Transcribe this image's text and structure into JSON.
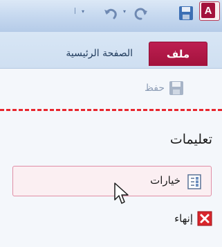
{
  "window": {
    "app_logo_letter": "A"
  },
  "ribbon": {
    "tabs": [
      {
        "label": "ملف",
        "active": true
      },
      {
        "label": "الصفحة الرئيسية",
        "active": false
      }
    ]
  },
  "backstage": {
    "save_label": "حفظ",
    "section_title": "تعليمات",
    "options_label": "خيارات",
    "exit_label": "إنهاء"
  },
  "colors": {
    "file_tab": "#a3123c",
    "divider": "#e8262e",
    "hover_border": "#e08da5"
  }
}
